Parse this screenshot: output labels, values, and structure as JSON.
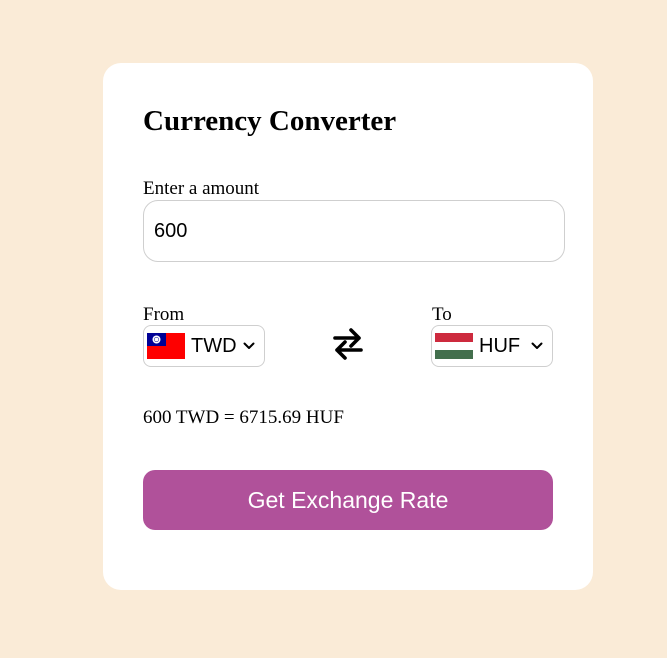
{
  "converter": {
    "title": "Currency Converter",
    "amount_label": "Enter a amount",
    "amount_value": "600",
    "from_label": "From",
    "to_label": "To",
    "from_currency": "TWD",
    "to_currency": "HUF",
    "result_text": "600 TWD = 6715.69 HUF",
    "button_label": "Get Exchange Rate"
  },
  "icons": {
    "from_flag": "taiwan-flag-icon",
    "to_flag": "hungary-flag-icon",
    "swap": "swap-arrows-icon",
    "dropdown": "chevron-down-icon"
  },
  "colors": {
    "page_background": "#faebd7",
    "card_background": "#ffffff",
    "button_background": "#b0519a",
    "button_text": "#ffffff"
  }
}
